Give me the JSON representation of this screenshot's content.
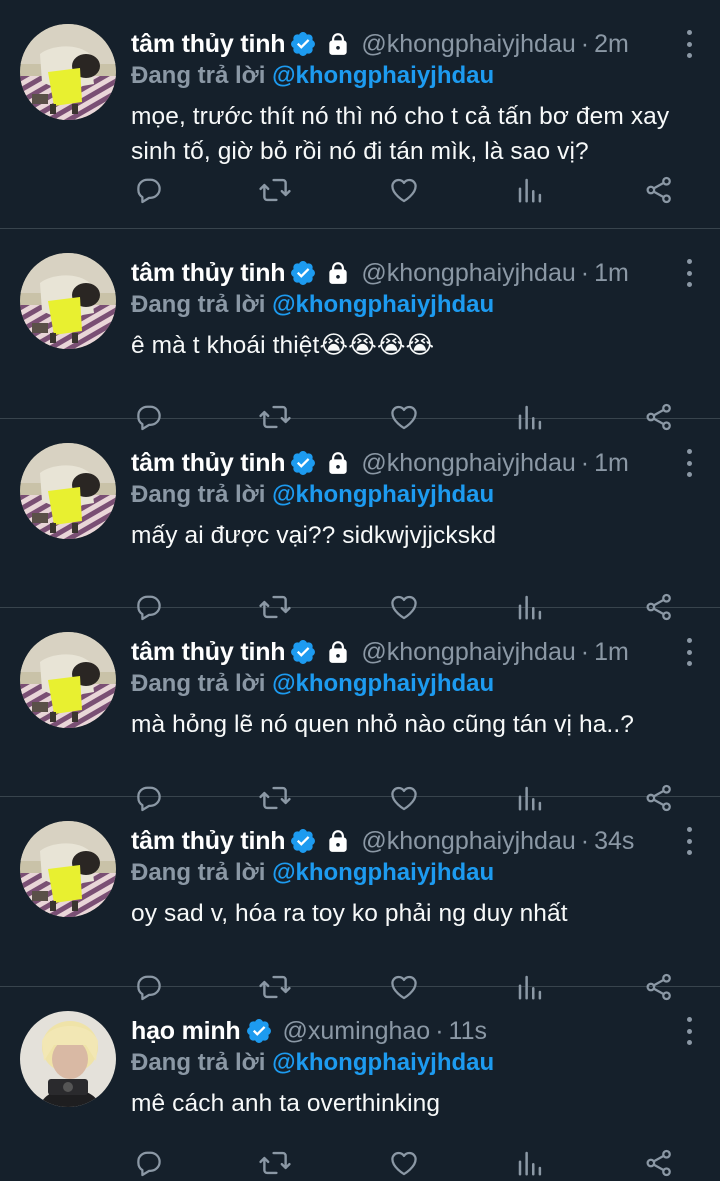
{
  "colors": {
    "background": "#15202b",
    "divider": "#38444d",
    "secondary_text": "#8b98a5",
    "accent": "#1d9bf0"
  },
  "tweets": [
    {
      "name": "tâm thủy tinh",
      "verified": true,
      "locked": true,
      "handle": "@khongphaiyjhdau",
      "separator": "·",
      "time": "2m",
      "reply_label": "Đang trả lời",
      "reply_to": "@khongphaiyjhdau",
      "text": "mọe, trước thít nó thì nó cho t cả tấn bơ đem xay sinh tố, giờ bỏ rồi nó đi tán mìk, là sao vị?",
      "avatar": "avatar-tam-icon"
    },
    {
      "name": "tâm thủy tinh",
      "verified": true,
      "locked": true,
      "handle": "@khongphaiyjhdau",
      "separator": "·",
      "time": "1m",
      "reply_label": "Đang trả lời",
      "reply_to": "@khongphaiyjhdau",
      "text": "ê mà t khoái thiệt😭😭😭😭",
      "avatar": "avatar-tam-icon"
    },
    {
      "name": "tâm thủy tinh",
      "verified": true,
      "locked": true,
      "handle": "@khongphaiyjhdau",
      "separator": "·",
      "time": "1m",
      "reply_label": "Đang trả lời",
      "reply_to": "@khongphaiyjhdau",
      "text": "mấy ai được vại?? sidkwjvjjckskd",
      "avatar": "avatar-tam-icon"
    },
    {
      "name": "tâm thủy tinh",
      "verified": true,
      "locked": true,
      "handle": "@khongphaiyjhdau",
      "separator": "·",
      "time": "1m",
      "reply_label": "Đang trả lời",
      "reply_to": "@khongphaiyjhdau",
      "text": "mà hỏng lẽ nó quen nhỏ nào cũng tán vị ha..?",
      "avatar": "avatar-tam-icon"
    },
    {
      "name": "tâm thủy tinh",
      "verified": true,
      "locked": true,
      "handle": "@khongphaiyjhdau",
      "separator": "·",
      "time": "34s",
      "reply_label": "Đang trả lời",
      "reply_to": "@khongphaiyjhdau",
      "text": "oy sad v, hóa ra toy ko phải ng duy nhất",
      "avatar": "avatar-tam-icon"
    },
    {
      "name": "hạo minh",
      "verified": true,
      "locked": false,
      "handle": "@xuminghao",
      "separator": "·",
      "time": "11s",
      "reply_label": "Đang trả lời",
      "reply_to": "@khongphaiyjhdau",
      "text": "mê cách anh ta overthinking",
      "avatar": "avatar-hao-icon"
    }
  ],
  "action_icons": [
    "reply-icon",
    "retweet-icon",
    "like-icon",
    "analytics-icon",
    "share-icon"
  ],
  "more_icon": "more-vertical-icon"
}
